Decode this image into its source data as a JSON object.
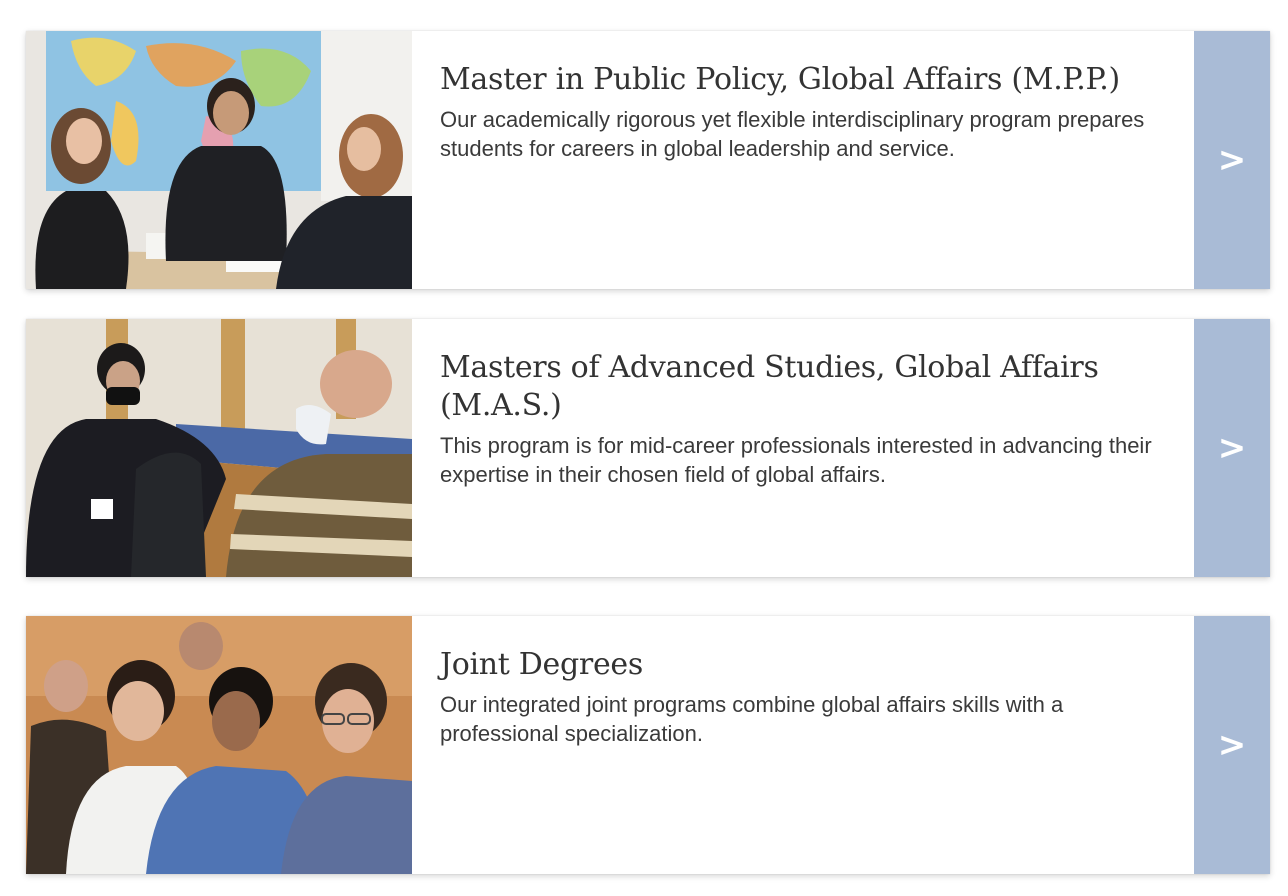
{
  "programs": [
    {
      "title": "Master in Public Policy, Global Affairs (M.P.P.)",
      "description": "Our academically rigorous yet flexible interdisciplinary program prepares students for careers in global leadership and service.",
      "arrow": ">"
    },
    {
      "title": "Masters of Advanced Studies, Global Affairs (M.A.S.)",
      "description": "This program is for mid-career professionals interested in advancing their expertise in their chosen field of global affairs.",
      "arrow": ">"
    },
    {
      "title": "Joint Degrees",
      "description": "Our integrated joint programs combine global affairs skills with a professional specialization.",
      "arrow": ">"
    }
  ],
  "colors": {
    "arrow_panel": "#a9bbd6",
    "title_text": "#333333",
    "body_text": "#3a3a3a"
  }
}
